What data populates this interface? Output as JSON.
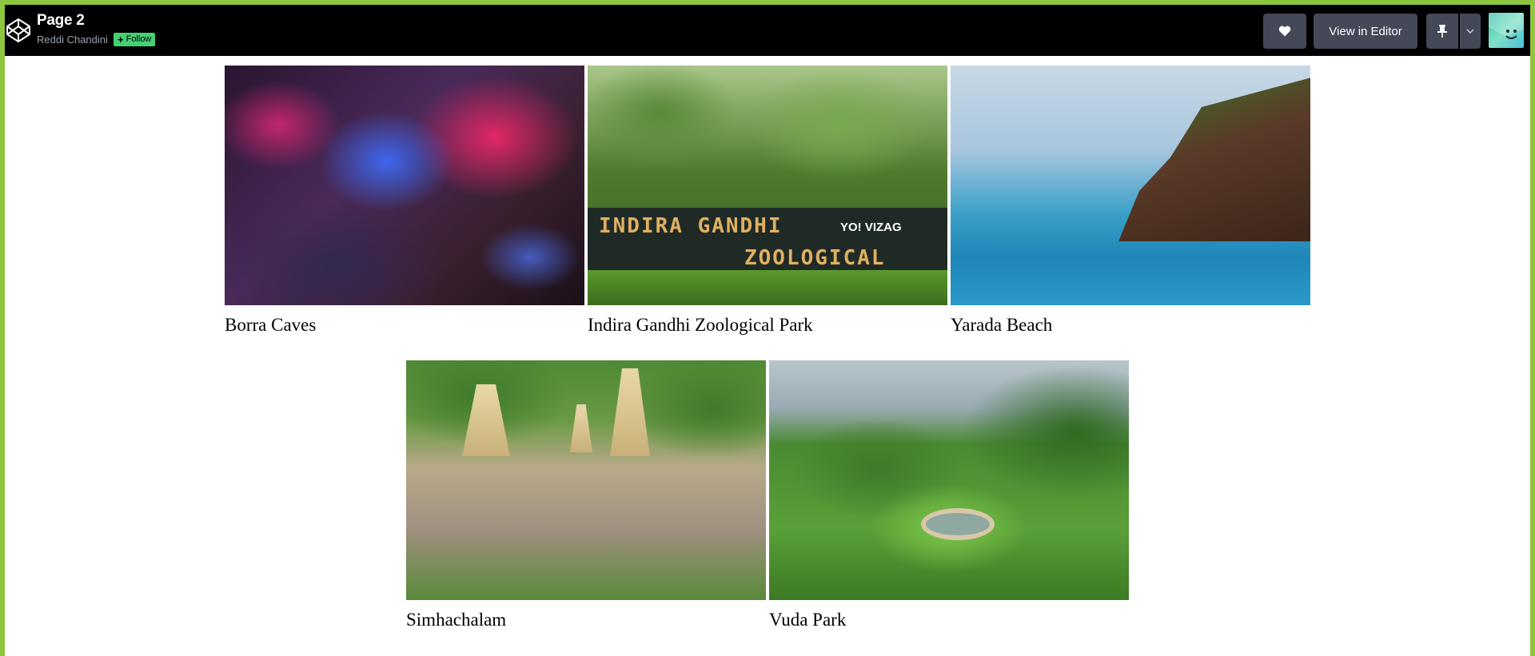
{
  "header": {
    "logo_icon": "codepen-logo-icon",
    "title": "Page 2",
    "author": "Reddi Chandini",
    "follow_label": "Follow",
    "follow_icon": "plus-icon",
    "heart_icon": "heart-icon",
    "editor_label": "View in Editor",
    "pin_icon": "pin-icon",
    "caret_icon": "chevron-down-icon",
    "avatar_icon": "user-avatar"
  },
  "gallery": {
    "items": [
      {
        "caption": "Borra Caves"
      },
      {
        "caption": "Indira Gandhi Zoological Park",
        "sign_line1": "INDIRA GANDHI",
        "sign_line2": "ZOOLOGICAL PARK",
        "sign_logo": "YO! VIZAG"
      },
      {
        "caption": "Yarada Beach"
      },
      {
        "caption": "Simhachalam"
      },
      {
        "caption": "Vuda Park"
      }
    ]
  },
  "colors": {
    "page_border": "#8ec63f",
    "topbar": "#000000",
    "button": "#444857",
    "follow": "#47cf73"
  }
}
